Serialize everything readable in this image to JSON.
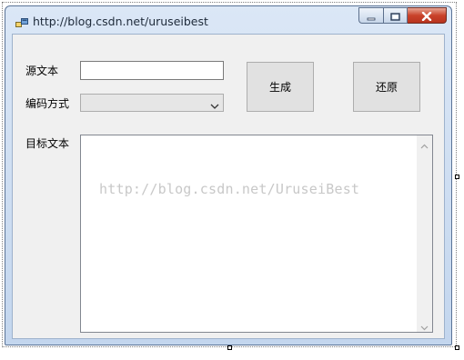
{
  "window": {
    "title": "http://blog.csdn.net/uruseibest",
    "icon": "winforms-app-icon",
    "caption_icons": [
      "minimize-icon",
      "maximize-icon",
      "close-icon"
    ]
  },
  "form": {
    "source_label": "源文本",
    "source_value": "",
    "encoding_label": "编码方式",
    "encoding_selected": "",
    "target_label": "目标文本",
    "target_value": "",
    "generate_button": "生成",
    "restore_button": "还原"
  },
  "watermark": "http://blog.csdn.net/UruseiBest",
  "colors": {
    "client_bg": "#f0f0f0",
    "titlebar": "#c3d6ee",
    "close_button": "#c9432b",
    "button_face": "#e1e1e1"
  }
}
